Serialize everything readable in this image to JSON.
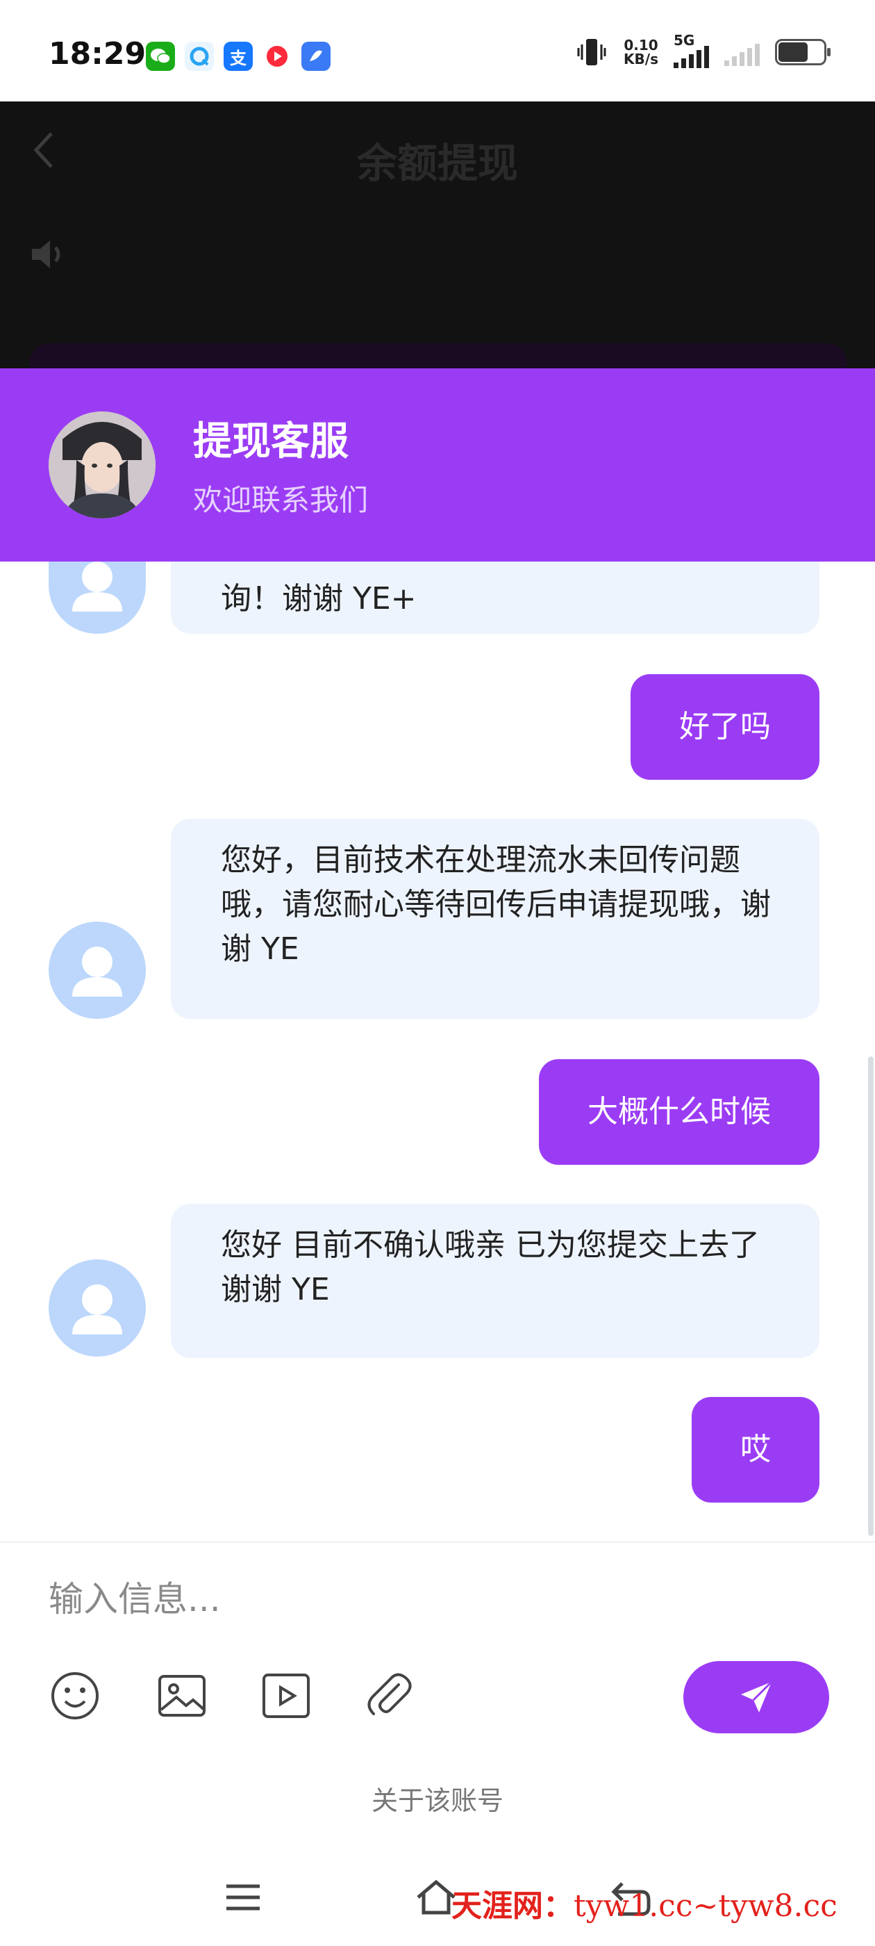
{
  "status_bar": {
    "time": "18:29",
    "apps": [
      {
        "name": "wechat-icon",
        "glyph": "",
        "color": "#1aad19"
      },
      {
        "name": "browser-icon",
        "glyph": "",
        "color": "#2aa4f4"
      },
      {
        "name": "alipay-icon",
        "glyph": "支",
        "color": "#1677ff"
      },
      {
        "name": "video-icon",
        "glyph": "",
        "color": "#ff2a3b"
      },
      {
        "name": "app-icon",
        "glyph": "",
        "color": "#3a7bf5"
      }
    ],
    "net_speed": "0.10",
    "net_unit": "KB/s",
    "network": "5G",
    "battery_level": 0.66
  },
  "page": {
    "title": "余额提现"
  },
  "agent": {
    "name": "提现客服",
    "subtitle": "欢迎联系我们"
  },
  "messages": [
    {
      "from": "agent",
      "text": "询！谢谢 YE+"
    },
    {
      "from": "user",
      "text": "好了吗"
    },
    {
      "from": "agent",
      "text": "您好，目前技术在处理流水未回传问题哦，请您耐心等待回传后申请提现哦，谢谢 YE"
    },
    {
      "from": "user",
      "text": "大概什么时候"
    },
    {
      "from": "agent",
      "text": "您好 目前不确认哦亲 已为您提交上去了 谢谢 YE"
    },
    {
      "from": "user",
      "text": "哎"
    }
  ],
  "composer": {
    "placeholder": "输入信息...",
    "value": ""
  },
  "footer": {
    "about_link": "关于该账号"
  },
  "watermark": {
    "site_name": "天涯网",
    "separator": "：",
    "url": "tyw1.cc~tyw8.cc"
  },
  "colors": {
    "accent": "#9b3cf5",
    "bubble_in": "#eef4fd",
    "avatar_bg": "#bcd7fb"
  }
}
